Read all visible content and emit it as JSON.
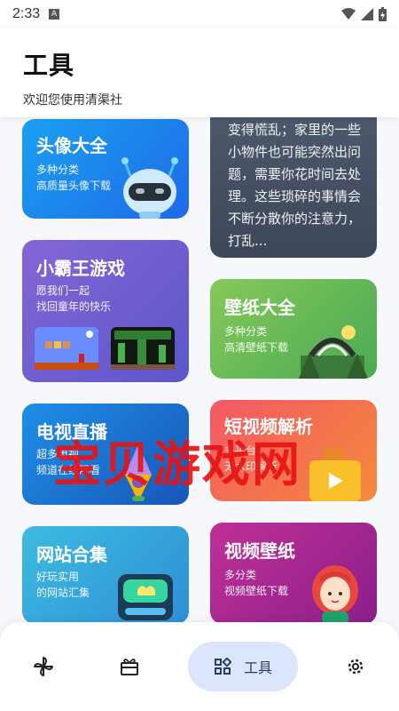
{
  "status": {
    "time": "2:33",
    "app_indicator": "A"
  },
  "header": {
    "title": "工具",
    "subtitle": "欢迎您使用清渠社"
  },
  "cards": {
    "avatar": {
      "title": "头像大全",
      "desc1": "多种分类",
      "desc2": "高质量头像下载"
    },
    "nes": {
      "title": "小霸王游戏",
      "desc1": "愿我们一起",
      "desc2": "找回童年的快乐"
    },
    "tv": {
      "title": "电视直播",
      "desc1": "超多电视",
      "desc2": "频道在线观看"
    },
    "site": {
      "title": "网站合集",
      "desc1": "好玩实用",
      "desc2": "的网站汇集"
    },
    "text": {
      "body": "变得慌乱；家里的一些小物件也可能突然出问题，需要你花时间去处理。这些琐碎的事情会不断分散你的注意力，打乱..."
    },
    "wallpaper": {
      "title": "壁纸大全",
      "desc1": "多种分类",
      "desc2": "高清壁纸下载"
    },
    "short": {
      "title": "短视频解析",
      "desc1": "多平台",
      "desc2": "无水印解析"
    },
    "video_wallpaper": {
      "title": "视频壁纸",
      "desc1": "多分类",
      "desc2": "视频壁纸下载"
    }
  },
  "watermark": "宝贝游戏网",
  "nav": {
    "items": [
      {
        "icon": "pinwheel-icon"
      },
      {
        "icon": "gift-box-icon"
      },
      {
        "icon": "grid-icon",
        "label": "工具"
      },
      {
        "icon": "gear-icon"
      }
    ]
  },
  "colors": {
    "accent": "#dbe5fb",
    "watermark": "#e61414"
  }
}
